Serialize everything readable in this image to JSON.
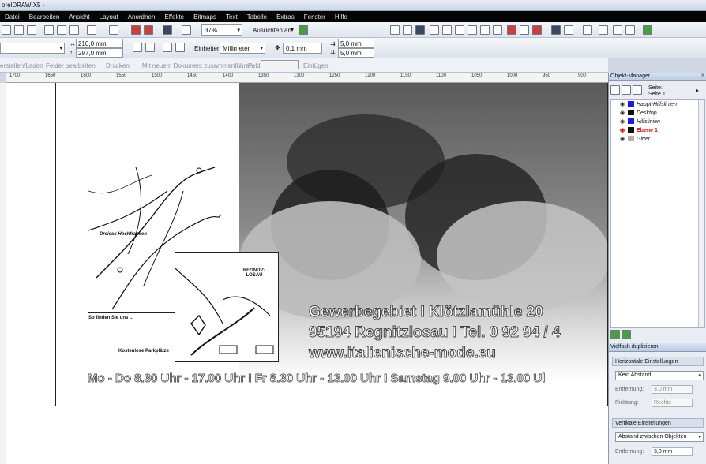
{
  "app": {
    "title": "orelDRAW X5 -"
  },
  "menu": [
    "Datei",
    "Bearbeiten",
    "Ansicht",
    "Layout",
    "Anordnen",
    "Effekte",
    "Bitmaps",
    "Text",
    "Tabelle",
    "Extras",
    "Fenster",
    "Hilfe"
  ],
  "toolbar": {
    "zoom": "37%",
    "snap_label": "Ausrichten an"
  },
  "propbar": {
    "width": "210,0 mm",
    "height": "297,0 mm",
    "units_label": "Einheiten:",
    "units_value": "Millimeter",
    "nudge": "0,1 mm",
    "dup_x": "5,0 mm",
    "dup_y": "5,0 mm"
  },
  "mergebar": {
    "create_load": "erstellen/Laden",
    "edit_fields": "Felder bearbeiten",
    "print": "Drucken",
    "merge_new": "Mit neuem Dokument zusammenführen",
    "field_label": "Feld:",
    "insert": "Einfügen"
  },
  "ruler": {
    "ticks": [
      "1700",
      "1650",
      "1600",
      "1550",
      "1500",
      "1450",
      "1400",
      "1350",
      "1300",
      "1250",
      "1200",
      "1150",
      "1100",
      "1050",
      "1000",
      "950",
      "900"
    ]
  },
  "flyer": {
    "address_line1": "Gewerbegebiet  I  Klötzlamühle 20",
    "address_line2": "95194 Regnitzlosau  I  Tel. 0 92 94 / 4",
    "website": "www.italienische-mode.eu",
    "hours": "Mo - Do 8.30 Uhr - 17.00 Uhr  I  Fr  8.30 Uhr - 13.00 Uhr  I  Samstag 9.00 Uhr - 13.00 Ul",
    "map_caption": "So finden Sie uns ...",
    "map_parking": "Kostenlose Parkplätze",
    "map_town": "REGNITZ-LOSAU",
    "map_region": "Dreieck Hochfranken"
  },
  "object_manager": {
    "title": "Objekt-Manager",
    "page_label": "Seite:",
    "page_value": "Seite 1",
    "layers": [
      {
        "name": "Haupt-Hilfslinien",
        "color": "#1b1bd9"
      },
      {
        "name": "Desktop",
        "color": "#111111"
      },
      {
        "name": "Hilfslinien",
        "color": "#1b1bd9"
      },
      {
        "name": "Ebene 1",
        "color": "#111111"
      },
      {
        "name": "Gitter",
        "color": "#b0b0b0"
      }
    ]
  },
  "step_repeat": {
    "title": "Vielfach duplizieren",
    "horizontal_title": "Horizontale Einstellungen",
    "horizontal_mode": "Kein Abstand",
    "h_distance_label": "Entfernung:",
    "h_distance": "3,0 mm",
    "h_direction_label": "Richtung:",
    "h_direction": "Rechts",
    "vertical_title": "Vertikale Einstellungen",
    "vertical_mode": "Abstand zwischen Objekten",
    "v_distance_label": "Entfernung:",
    "v_distance": "3,0 mm"
  },
  "colors": {
    "accent": "#1b1bd9",
    "active_layer": "#d01414"
  }
}
